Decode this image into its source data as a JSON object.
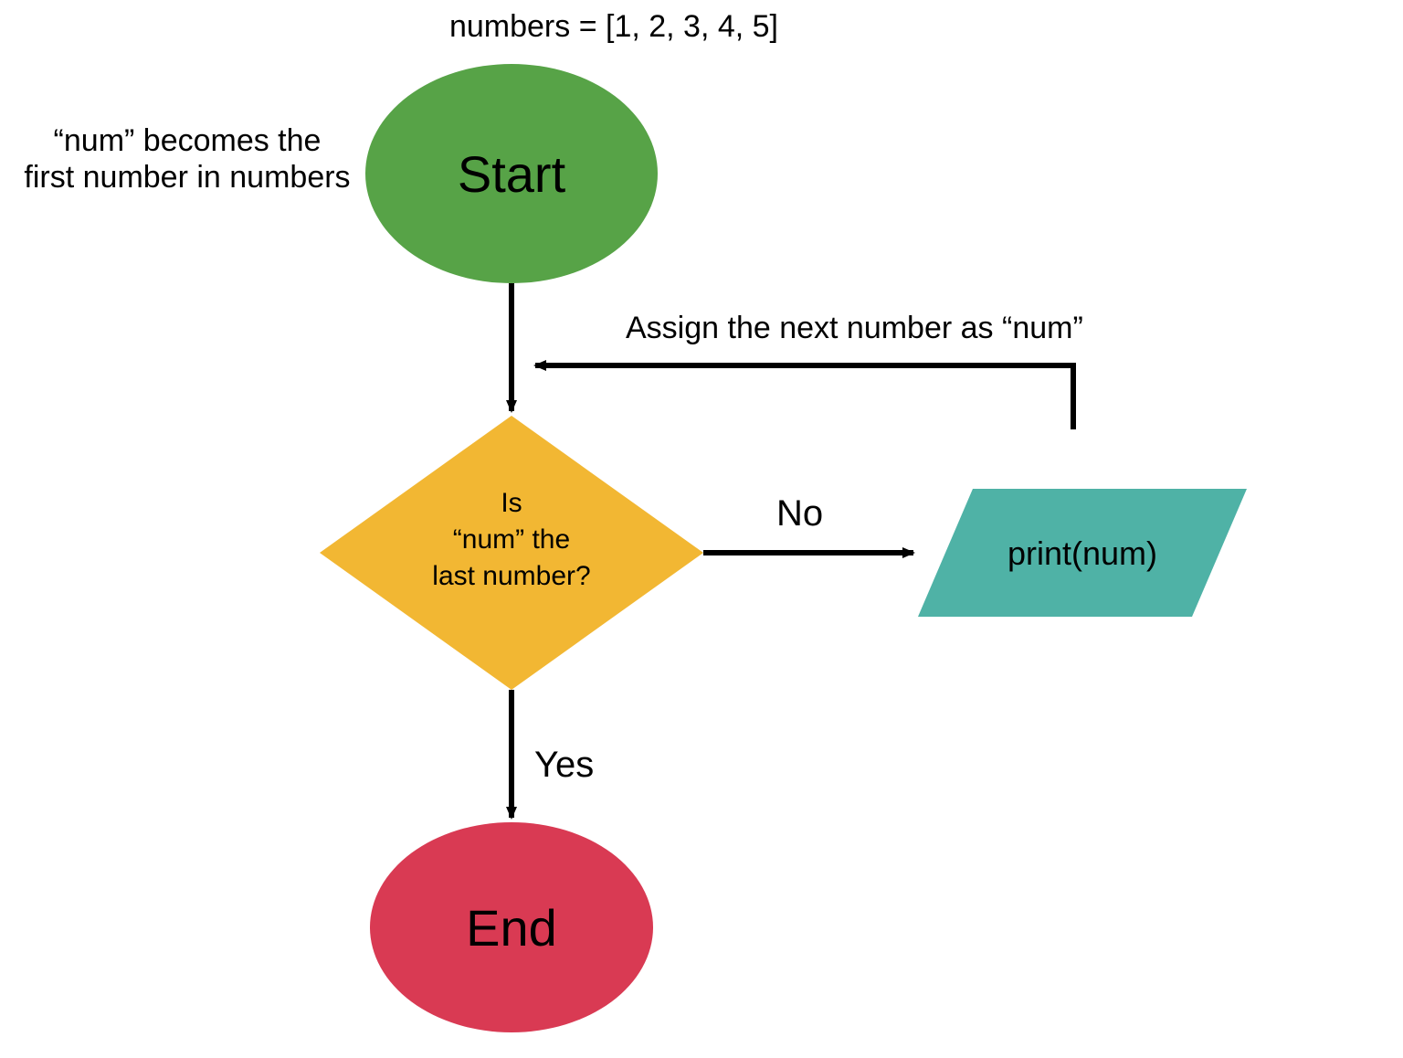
{
  "captions": {
    "numbers_decl": "numbers = [1, 2, 3, 4, 5]",
    "first_assign_l1": "“num” becomes the",
    "first_assign_l2": "first number in numbers",
    "loop_assign": "Assign the next number as “num”"
  },
  "nodes": {
    "start": "Start",
    "decision_l1": "Is",
    "decision_l2": "“num” the",
    "decision_l3": "last number?",
    "process": "print(num)",
    "end": "End"
  },
  "edges": {
    "no": "No",
    "yes": "Yes"
  },
  "colors": {
    "start": "#57a347",
    "decision": "#f2b733",
    "process": "#4fb2a6",
    "end": "#d93a53",
    "stroke": "#000000"
  }
}
